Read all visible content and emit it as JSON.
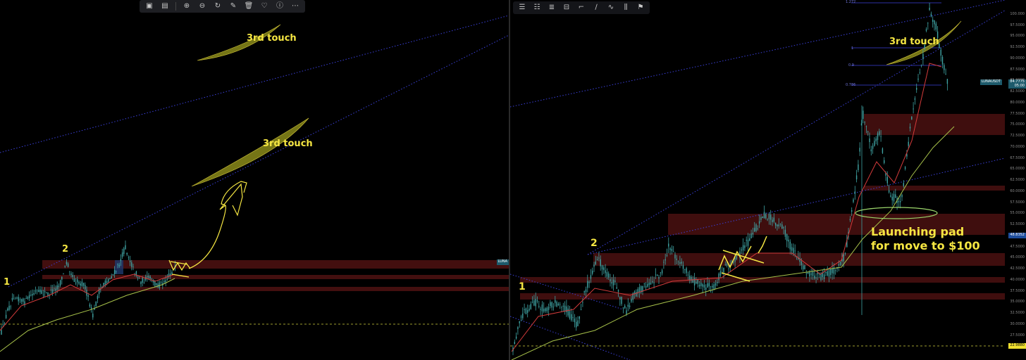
{
  "left_toolbar": {
    "icons": [
      "image-icon",
      "image-edit-icon",
      "zoom-in-icon",
      "zoom-out-icon",
      "refresh-icon",
      "edit-icon",
      "delete-icon",
      "heart-icon",
      "info-icon",
      "more-icon"
    ]
  },
  "right_toolbar": {
    "icons": [
      "lines-icon",
      "lines-icon",
      "fib-icon",
      "fib-icon",
      "brush-icon",
      "pen-icon",
      "wave-icon",
      "bars-icon",
      "flag-icon"
    ]
  },
  "left_chart": {
    "annotations": {
      "touch_upper": "3rd touch",
      "touch_lower": "3rd touch",
      "point_1": "1",
      "point_2": "2"
    },
    "price_tag": "LUNA"
  },
  "right_chart": {
    "annotations": {
      "touch": "3rd touch",
      "point_1": "1",
      "point_2": "2",
      "launch_line1": "Launching pad",
      "launch_line2": "for move to $100"
    },
    "symbol_tag": "LUNAUSDT",
    "price_tag": {
      "price": "84.7775",
      "countdown": "05:00"
    },
    "level_tag": "48.8352",
    "low_tag": "22.9880",
    "fib_labels": [
      "1.272",
      "1",
      "0.9",
      "0.786"
    ],
    "y_ticks": [
      "100.000",
      "97.5000",
      "95.0000",
      "92.5000",
      "90.0000",
      "87.5000",
      "85.0000",
      "82.5000",
      "80.0000",
      "77.5000",
      "75.0000",
      "72.5000",
      "70.0000",
      "67.5000",
      "65.0000",
      "62.5000",
      "60.0000",
      "57.5000",
      "55.0000",
      "52.5000",
      "50.0000",
      "47.5000",
      "45.0000",
      "42.5000",
      "40.0000",
      "37.5000",
      "35.0000",
      "32.5000",
      "30.0000",
      "27.5000",
      "25.0000"
    ],
    "y_axis": {
      "min": 22.5,
      "max": 102.5
    }
  },
  "colors": {
    "zone": "#5a1414",
    "zone_blue": "#1f3a6e",
    "trendline": "#3a3fd8",
    "candle": "#3fa3a3",
    "ema_fast": "#d43b3b",
    "ema_slow": "#a7c14a",
    "annotation": "#f5e642",
    "touch_fill": "#8a8a1a",
    "ellipse": "#9ad46a",
    "dashed_low": "#9b9b2e",
    "tag_teal": "#1d5a6b",
    "tag_blue": "#1e4d9c",
    "tag_yellow": "#f0e030"
  }
}
